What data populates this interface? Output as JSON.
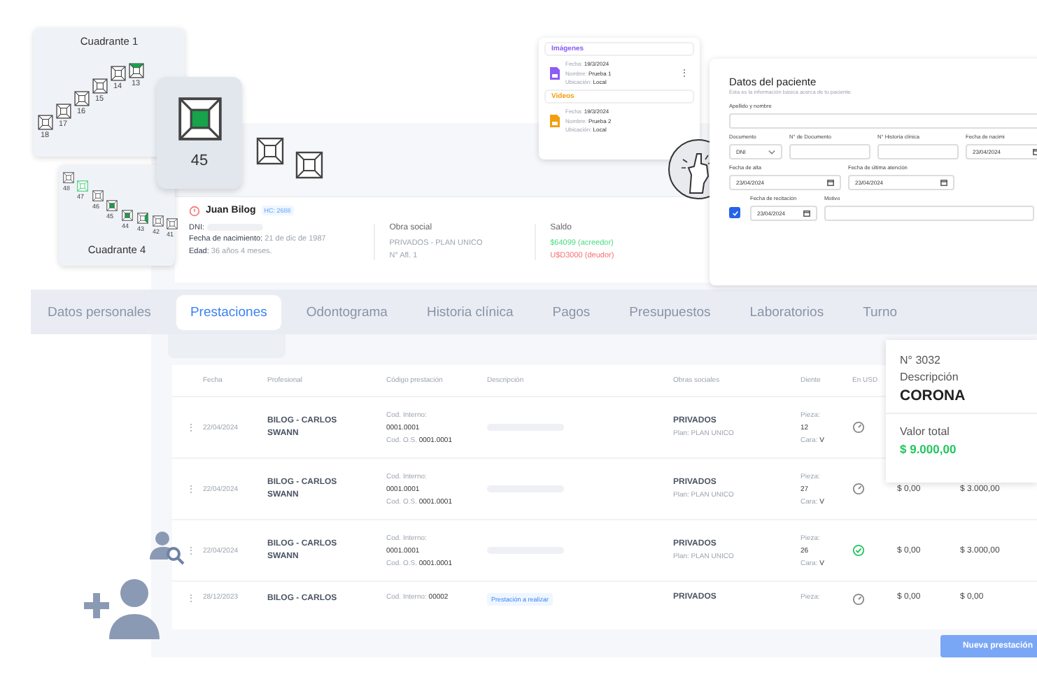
{
  "quadrants": [
    {
      "title": "Cuadrante 1",
      "teeth": [
        {
          "number": "18",
          "kind": "plain"
        },
        {
          "number": "17",
          "kind": "plain"
        },
        {
          "number": "16",
          "kind": "plain"
        },
        {
          "number": "15",
          "kind": "plain"
        },
        {
          "number": "14",
          "kind": "plain"
        },
        {
          "number": "13",
          "kind": "top"
        }
      ]
    },
    {
      "title": "Cuadrante 4",
      "teeth": [
        {
          "number": "48",
          "kind": "plain"
        },
        {
          "number": "47",
          "kind": "outline"
        },
        {
          "number": "46",
          "kind": "plain"
        },
        {
          "number": "45",
          "kind": "center"
        },
        {
          "number": "44",
          "kind": "center"
        },
        {
          "number": "43",
          "kind": "right"
        },
        {
          "number": "42",
          "kind": "plain"
        },
        {
          "number": "41",
          "kind": "plain"
        }
      ]
    }
  ],
  "selected_tooth": {
    "number": "45",
    "kind": "center"
  },
  "media": [
    {
      "title": "Imágenes",
      "color": "#8b5cf6",
      "lines": [
        {
          "label": "Fecha:",
          "value": "19/3/2024"
        },
        {
          "label": "Nombre:",
          "value": "Prueba 1"
        },
        {
          "label": "Ubicación:",
          "value": "Local"
        }
      ],
      "menu": "⋮"
    },
    {
      "title": "Videos",
      "color": "#f59e0b",
      "lines": [
        {
          "label": "Fecha:",
          "value": "19/3/2024"
        },
        {
          "label": "Nombre:",
          "value": "Prueba 2"
        },
        {
          "label": "Ubicación:",
          "value": "Local"
        }
      ]
    }
  ],
  "form": {
    "title": "Datos del paciente",
    "subtitle": "Esta es la información básica acerca de tu paciente.",
    "rows": [
      [
        {
          "kind": "text",
          "label": "Apellido y nombre"
        }
      ],
      [
        {
          "kind": "select",
          "label": "Documento",
          "value": "DNI"
        },
        {
          "kind": "text",
          "label": "N° de Documento"
        },
        {
          "kind": "text",
          "label": "N° Historia clínica"
        },
        {
          "kind": "date",
          "label": "Fecha de nacimi",
          "value": "23/04/2024"
        }
      ],
      [
        {
          "kind": "date",
          "label": "Fecha de alta",
          "value": "23/04/2024"
        },
        {
          "kind": "date",
          "label": "Fecha de última atención",
          "value": "23/04/2024"
        }
      ],
      [
        {
          "kind": "checkbox",
          "checked": true
        },
        {
          "kind": "date",
          "label": "Fecha de recitación",
          "value": "23/04/2024"
        },
        {
          "kind": "text",
          "label": "Motivo"
        }
      ]
    ]
  },
  "patient": {
    "name": "Juan Bilog",
    "hc": "HC: 2688",
    "dni_label": "DNI:",
    "birth_label": "Fecha de nacimiento:",
    "birth": "21 de dic de 1987",
    "age_label": "Edad:",
    "age": "36 años 4 meses.",
    "obra_title": "Obra social",
    "obra_lines": [
      "PRIVADOS - PLAN UNICO",
      "N° Afl. 1"
    ],
    "saldo_title": "Saldo",
    "saldos": [
      {
        "text": "$64099 (acreedor)",
        "color": "#4ade80"
      },
      {
        "text": "U$D3000 (deudor)",
        "color": "#f87171"
      }
    ]
  },
  "tabs": [
    {
      "label": "Datos personales",
      "selected": false
    },
    {
      "label": "Prestaciones",
      "selected": true
    },
    {
      "label": "Odontograma",
      "selected": false
    },
    {
      "label": "Historia clínica",
      "selected": false
    },
    {
      "label": "Pagos",
      "selected": false
    },
    {
      "label": "Presupuestos",
      "selected": false
    },
    {
      "label": "Laboratorios",
      "selected": false
    },
    {
      "label": "Turno",
      "selected": false
    }
  ],
  "table": {
    "columns": [
      "",
      "Fecha",
      "Profesional",
      "Código prestación",
      "Descripción",
      "Obras sociales",
      "Diente",
      "En USD"
    ],
    "rows": [
      {
        "menu": "⋮",
        "date": "22/04/2024",
        "professional": "BILOG - CARLOS SWANN",
        "code": [
          "Cod. Interno:",
          "**0001.0001**",
          "Cod. O.S. **0001.0001**"
        ],
        "description": {
          "kind": "redacted"
        },
        "obra": "PRIVADOS",
        "plan": "Plan: PLAN UNICO",
        "tooth": [
          "Pieza:",
          "**12**",
          "Cara: **V**"
        ],
        "usd_done": false
      },
      {
        "menu": "⋮",
        "date": "22/04/2024",
        "professional": "BILOG - CARLOS SWANN",
        "code": [
          "Cod. Interno:",
          "**0001.0001**",
          "Cod. O.S. **0001.0001**"
        ],
        "description": {
          "kind": "redacted"
        },
        "obra": "PRIVADOS",
        "plan": "Plan: PLAN UNICO",
        "tooth": [
          "Pieza:",
          "**27**",
          "Cara: **V**"
        ],
        "usd_done": false,
        "amount_1": "$ 0,00",
        "amount_2": "$ 3.000,00"
      },
      {
        "menu": "⋮",
        "date": "22/04/2024",
        "professional": "BILOG - CARLOS SWANN",
        "code": [
          "Cod. Interno:",
          "**0001.0001**",
          "Cod. O.S. **0001.0001**"
        ],
        "description": {
          "kind": "redacted"
        },
        "obra": "PRIVADOS",
        "plan": "Plan: PLAN UNICO",
        "tooth": [
          "Pieza:",
          "**26**",
          "Cara: **V**"
        ],
        "usd_done": true,
        "amount_1": "$ 0,00",
        "amount_2": "$ 3.000,00"
      },
      {
        "menu": "⋮",
        "date": "28/12/2023",
        "professional": "BILOG - CARLOS",
        "code": [
          "Cod. Interno: **00002**"
        ],
        "description": {
          "kind": "badge",
          "text": "Prestación a realizar"
        },
        "obra": "PRIVADOS",
        "tooth": [
          "Pieza:"
        ],
        "usd_done": false,
        "amount_1": "$ 0,00",
        "amount_2": "$ 0,00"
      }
    ]
  },
  "detail": {
    "number": "N° 3032",
    "desc_label": "Descripción",
    "desc": "CORONA",
    "total_label": "Valor total",
    "total": "$ 9.000,00"
  },
  "new_button": "Nueva prestación"
}
